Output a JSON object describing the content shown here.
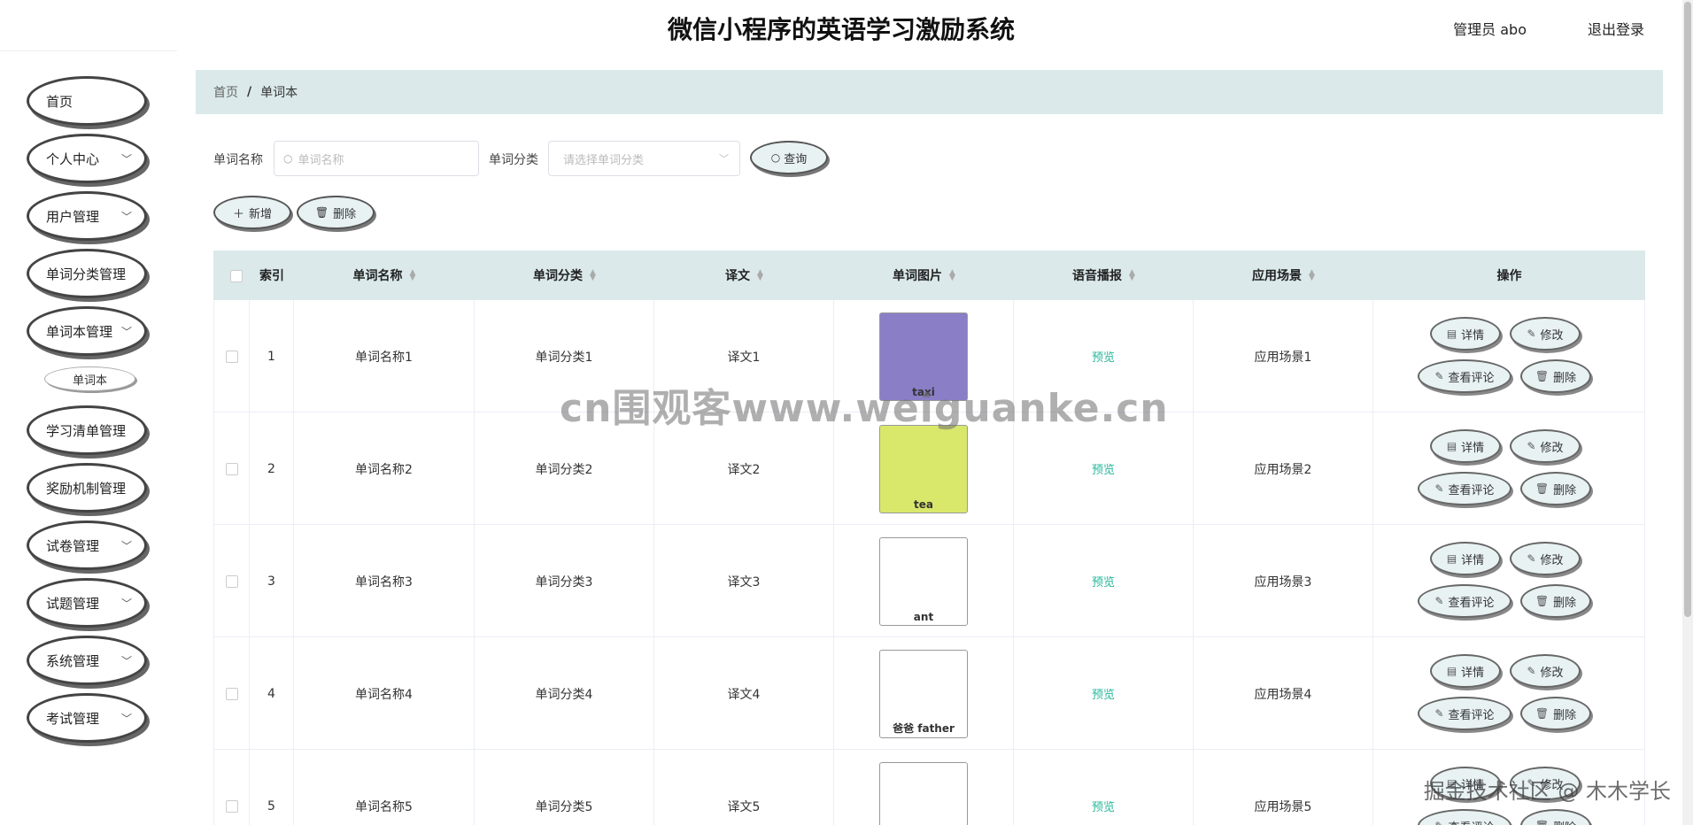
{
  "header": {
    "title": "微信小程序的英语学习激励系统",
    "user": "管理员 abo",
    "logout": "退出登录"
  },
  "sidebar": {
    "items": [
      {
        "label": "首页",
        "arrow": false
      },
      {
        "label": "个人中心",
        "arrow": true
      },
      {
        "label": "用户管理",
        "arrow": true
      },
      {
        "label": "单词分类管理",
        "arrow": false
      },
      {
        "label": "单词本管理",
        "arrow": true
      },
      {
        "label": "学习清单管理",
        "arrow": false
      },
      {
        "label": "奖励机制管理",
        "arrow": false
      },
      {
        "label": "试卷管理",
        "arrow": true
      },
      {
        "label": "试题管理",
        "arrow": true
      },
      {
        "label": "系统管理",
        "arrow": true
      },
      {
        "label": "考试管理",
        "arrow": true
      }
    ],
    "sub_item": "单词本"
  },
  "breadcrumb": {
    "home": "首页",
    "sep": "/",
    "current": "单词本"
  },
  "search": {
    "name_label": "单词名称",
    "name_placeholder": "单词名称",
    "category_label": "单词分类",
    "category_placeholder": "请选择单词分类",
    "query_btn": "查询"
  },
  "actions": {
    "add": "新增",
    "delete": "删除"
  },
  "table": {
    "headers": [
      "索引",
      "单词名称",
      "单词分类",
      "译文",
      "单词图片",
      "语音播报",
      "应用场景",
      "操作"
    ],
    "rows": [
      {
        "index": "1",
        "name": "单词名称1",
        "category": "单词分类1",
        "translation": "译文1",
        "image_caption": "taxi",
        "audio": "预览",
        "scene": "应用场景1"
      },
      {
        "index": "2",
        "name": "单词名称2",
        "category": "单词分类2",
        "translation": "译文2",
        "image_caption": "tea",
        "audio": "预览",
        "scene": "应用场景2"
      },
      {
        "index": "3",
        "name": "单词名称3",
        "category": "单词分类3",
        "translation": "译文3",
        "image_caption": "ant",
        "audio": "预览",
        "scene": "应用场景3"
      },
      {
        "index": "4",
        "name": "单词名称4",
        "category": "单词分类4",
        "translation": "译文4",
        "image_caption": "爸爸 father",
        "audio": "预览",
        "scene": "应用场景4"
      },
      {
        "index": "5",
        "name": "单词名称5",
        "category": "单词分类5",
        "translation": "译文5",
        "image_caption": "",
        "audio": "预览",
        "scene": "应用场景5"
      }
    ],
    "row_actions": {
      "detail": "详情",
      "edit": "修改",
      "comments": "查看评论",
      "delete": "删除"
    }
  },
  "watermarks": {
    "center": "cn围观客www.weiguanke.cn",
    "corner": "掘金技术社区 @ 木木学长"
  },
  "colors": {
    "accent_bg": "#dbe9ea",
    "preview_link": "#25b79a"
  }
}
